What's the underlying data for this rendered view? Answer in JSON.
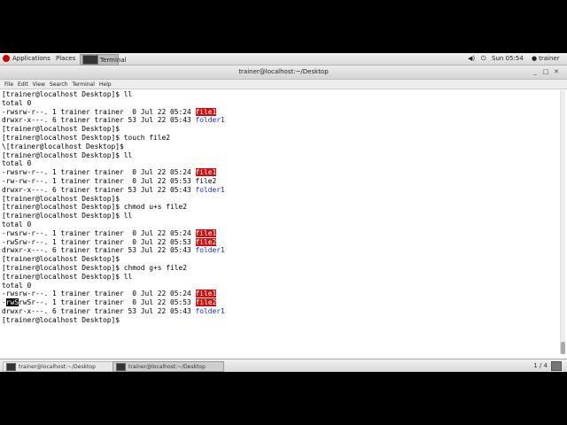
{
  "top_panel": {
    "applications": "Applications",
    "places": "Places",
    "terminal_launcher": "Terminal",
    "clock": "Sun 05:54",
    "user": "trainer"
  },
  "window": {
    "title": "trainer@localhost:~/Desktop"
  },
  "menubar": {
    "items": [
      "File",
      "Edit",
      "View",
      "Search",
      "Terminal",
      "Help"
    ]
  },
  "terminal": {
    "lines": [
      [
        {
          "t": "[trainer@localhost Desktop]$ ll"
        }
      ],
      [
        {
          "t": "total 0"
        }
      ],
      [
        {
          "t": "-rwsrw-r--. 1 trainer trainer  0 Jul 22 05:24 "
        },
        {
          "t": "file1",
          "c": "hl-red"
        }
      ],
      [
        {
          "t": "drwxr-x---. 6 trainer trainer 53 Jul 22 05:43 "
        },
        {
          "t": "folder1",
          "c": "blue"
        }
      ],
      [
        {
          "t": "[trainer@localhost Desktop]$"
        }
      ],
      [
        {
          "t": "[trainer@localhost Desktop]$ touch file2"
        }
      ],
      [
        {
          "t": "\\[trainer@localhost Desktop]$"
        }
      ],
      [
        {
          "t": "[trainer@localhost Desktop]$ ll"
        }
      ],
      [
        {
          "t": "total 0"
        }
      ],
      [
        {
          "t": "-rwsrw-r--. 1 trainer trainer  0 Jul 22 05:24 "
        },
        {
          "t": "file1",
          "c": "hl-red"
        }
      ],
      [
        {
          "t": "-rw-rw-r--. 1 trainer trainer  0 Jul 22 05:53 file2"
        }
      ],
      [
        {
          "t": "drwxr-x---. 6 trainer trainer 53 Jul 22 05:43 "
        },
        {
          "t": "folder1",
          "c": "blue"
        }
      ],
      [
        {
          "t": "[trainer@localhost Desktop]$"
        }
      ],
      [
        {
          "t": "[trainer@localhost Desktop]$ chmod u+s file2"
        }
      ],
      [
        {
          "t": "[trainer@localhost Desktop]$ ll"
        }
      ],
      [
        {
          "t": "total 0"
        }
      ],
      [
        {
          "t": "-rwsrw-r--. 1 trainer trainer  0 Jul 22 05:24 "
        },
        {
          "t": "file1",
          "c": "hl-red"
        }
      ],
      [
        {
          "t": "-rwSrw-r--. 1 trainer trainer  0 Jul 22 05:53 "
        },
        {
          "t": "file2",
          "c": "hl-red"
        }
      ],
      [
        {
          "t": "drwxr-x---. 6 trainer trainer 53 Jul 22 05:43 "
        },
        {
          "t": "folder1",
          "c": "blue"
        }
      ],
      [
        {
          "t": "[trainer@localhost Desktop]$"
        }
      ],
      [
        {
          "t": "[trainer@localhost Desktop]$ chmod g+s file2"
        }
      ],
      [
        {
          "t": "[trainer@localhost Desktop]$ ll"
        }
      ],
      [
        {
          "t": "total 0"
        }
      ],
      [
        {
          "t": "-rwsrw-r--. 1 trainer trainer  0 Jul 22 05:24 "
        },
        {
          "t": "file1",
          "c": "hl-red"
        }
      ],
      [
        {
          "t": "-"
        },
        {
          "t": "rwS",
          "c": "cursor-inv"
        },
        {
          "t": "rwSr--. 1 trainer trainer  0 Jul 22 05:53 "
        },
        {
          "t": "file2",
          "c": "hl-red"
        }
      ],
      [
        {
          "t": "drwxr-x---. 6 trainer trainer 53 Jul 22 05:43 "
        },
        {
          "t": "folder1",
          "c": "blue"
        }
      ],
      [
        {
          "t": "[trainer@localhost Desktop]$"
        }
      ]
    ]
  },
  "taskbar": {
    "tasks": [
      "trainer@localhost:~/Desktop",
      "trainer@localhost:~/Desktop"
    ],
    "pager": "1 / 4"
  }
}
